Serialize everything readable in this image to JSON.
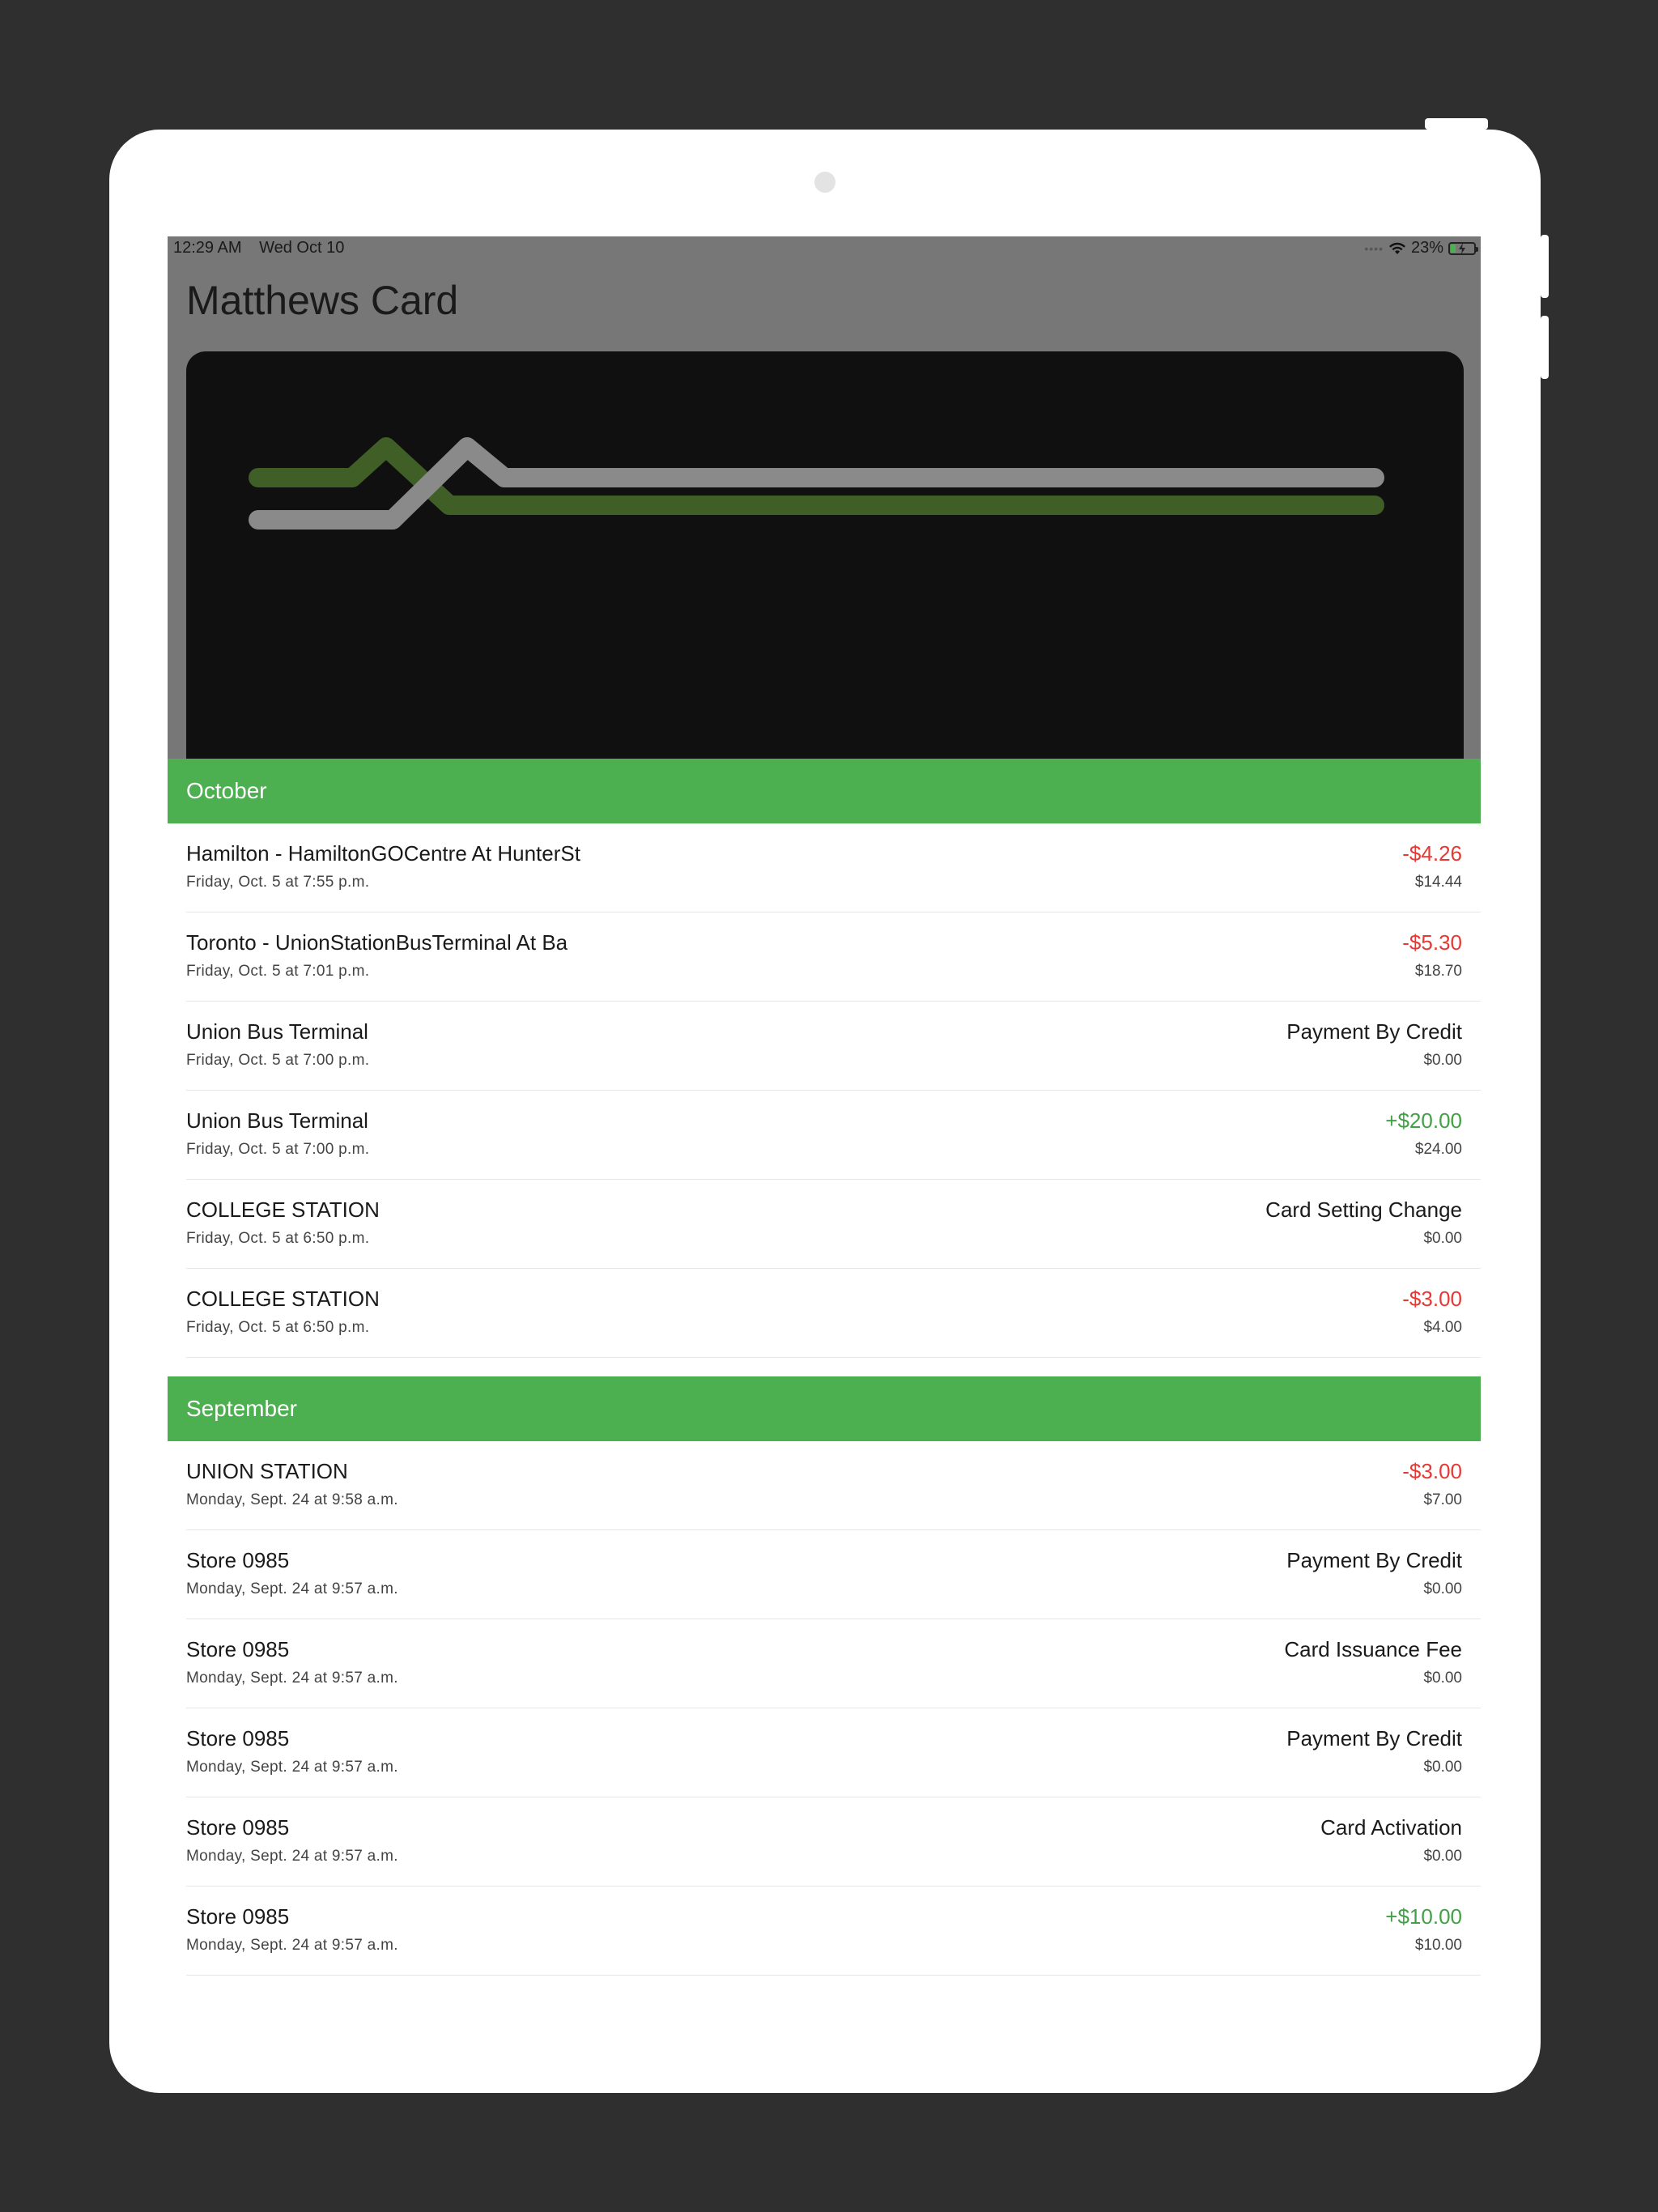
{
  "status_bar": {
    "time": "12:29 AM",
    "date": "Wed Oct 10",
    "battery": "23%",
    "battery_level": 0.23,
    "icons": [
      "signal-dots-icon",
      "wifi-icon",
      "battery-charging-icon"
    ]
  },
  "header": {
    "title": "Matthews Card"
  },
  "colors": {
    "accent": "#4caf50",
    "negative": "#e53935",
    "positive": "#43a047",
    "card_background": "#101010",
    "card_stripe_green": "#3f5f26",
    "card_stripe_gray": "#8a8a8a"
  },
  "sections": [
    {
      "month": "October",
      "transactions": [
        {
          "name": "Hamilton - HamiltonGOCentre At HunterSt",
          "date": "Friday, Oct. 5 at 7:55 p.m.",
          "amount": "-$4.26",
          "type": "neg",
          "balance": "$14.44"
        },
        {
          "name": "Toronto - UnionStationBusTerminal At Ba",
          "date": "Friday, Oct. 5 at 7:01 p.m.",
          "amount": "-$5.30",
          "type": "neg",
          "balance": "$18.70"
        },
        {
          "name": "Union Bus Terminal",
          "date": "Friday, Oct. 5 at 7:00 p.m.",
          "amount": "Payment By Credit",
          "type": "text",
          "balance": "$0.00"
        },
        {
          "name": "Union Bus Terminal",
          "date": "Friday, Oct. 5 at 7:00 p.m.",
          "amount": "+$20.00",
          "type": "pos",
          "balance": "$24.00"
        },
        {
          "name": "COLLEGE STATION",
          "date": "Friday, Oct. 5 at 6:50 p.m.",
          "amount": "Card Setting Change",
          "type": "text",
          "balance": "$0.00"
        },
        {
          "name": "COLLEGE STATION",
          "date": "Friday, Oct. 5 at 6:50 p.m.",
          "amount": "-$3.00",
          "type": "neg",
          "balance": "$4.00"
        }
      ]
    },
    {
      "month": "September",
      "transactions": [
        {
          "name": "UNION STATION",
          "date": "Monday, Sept. 24 at 9:58 a.m.",
          "amount": "-$3.00",
          "type": "neg",
          "balance": "$7.00"
        },
        {
          "name": "Store 0985",
          "date": "Monday, Sept. 24 at 9:57 a.m.",
          "amount": "Payment By Credit",
          "type": "text",
          "balance": "$0.00"
        },
        {
          "name": "Store 0985",
          "date": "Monday, Sept. 24 at 9:57 a.m.",
          "amount": "Card Issuance Fee",
          "type": "text",
          "balance": "$0.00"
        },
        {
          "name": "Store 0985",
          "date": "Monday, Sept. 24 at 9:57 a.m.",
          "amount": "Payment By Credit",
          "type": "text",
          "balance": "$0.00"
        },
        {
          "name": "Store 0985",
          "date": "Monday, Sept. 24 at 9:57 a.m.",
          "amount": "Card Activation",
          "type": "text",
          "balance": "$0.00"
        },
        {
          "name": "Store 0985",
          "date": "Monday, Sept. 24 at 9:57 a.m.",
          "amount": "+$10.00",
          "type": "pos",
          "balance": "$10.00"
        }
      ]
    }
  ]
}
